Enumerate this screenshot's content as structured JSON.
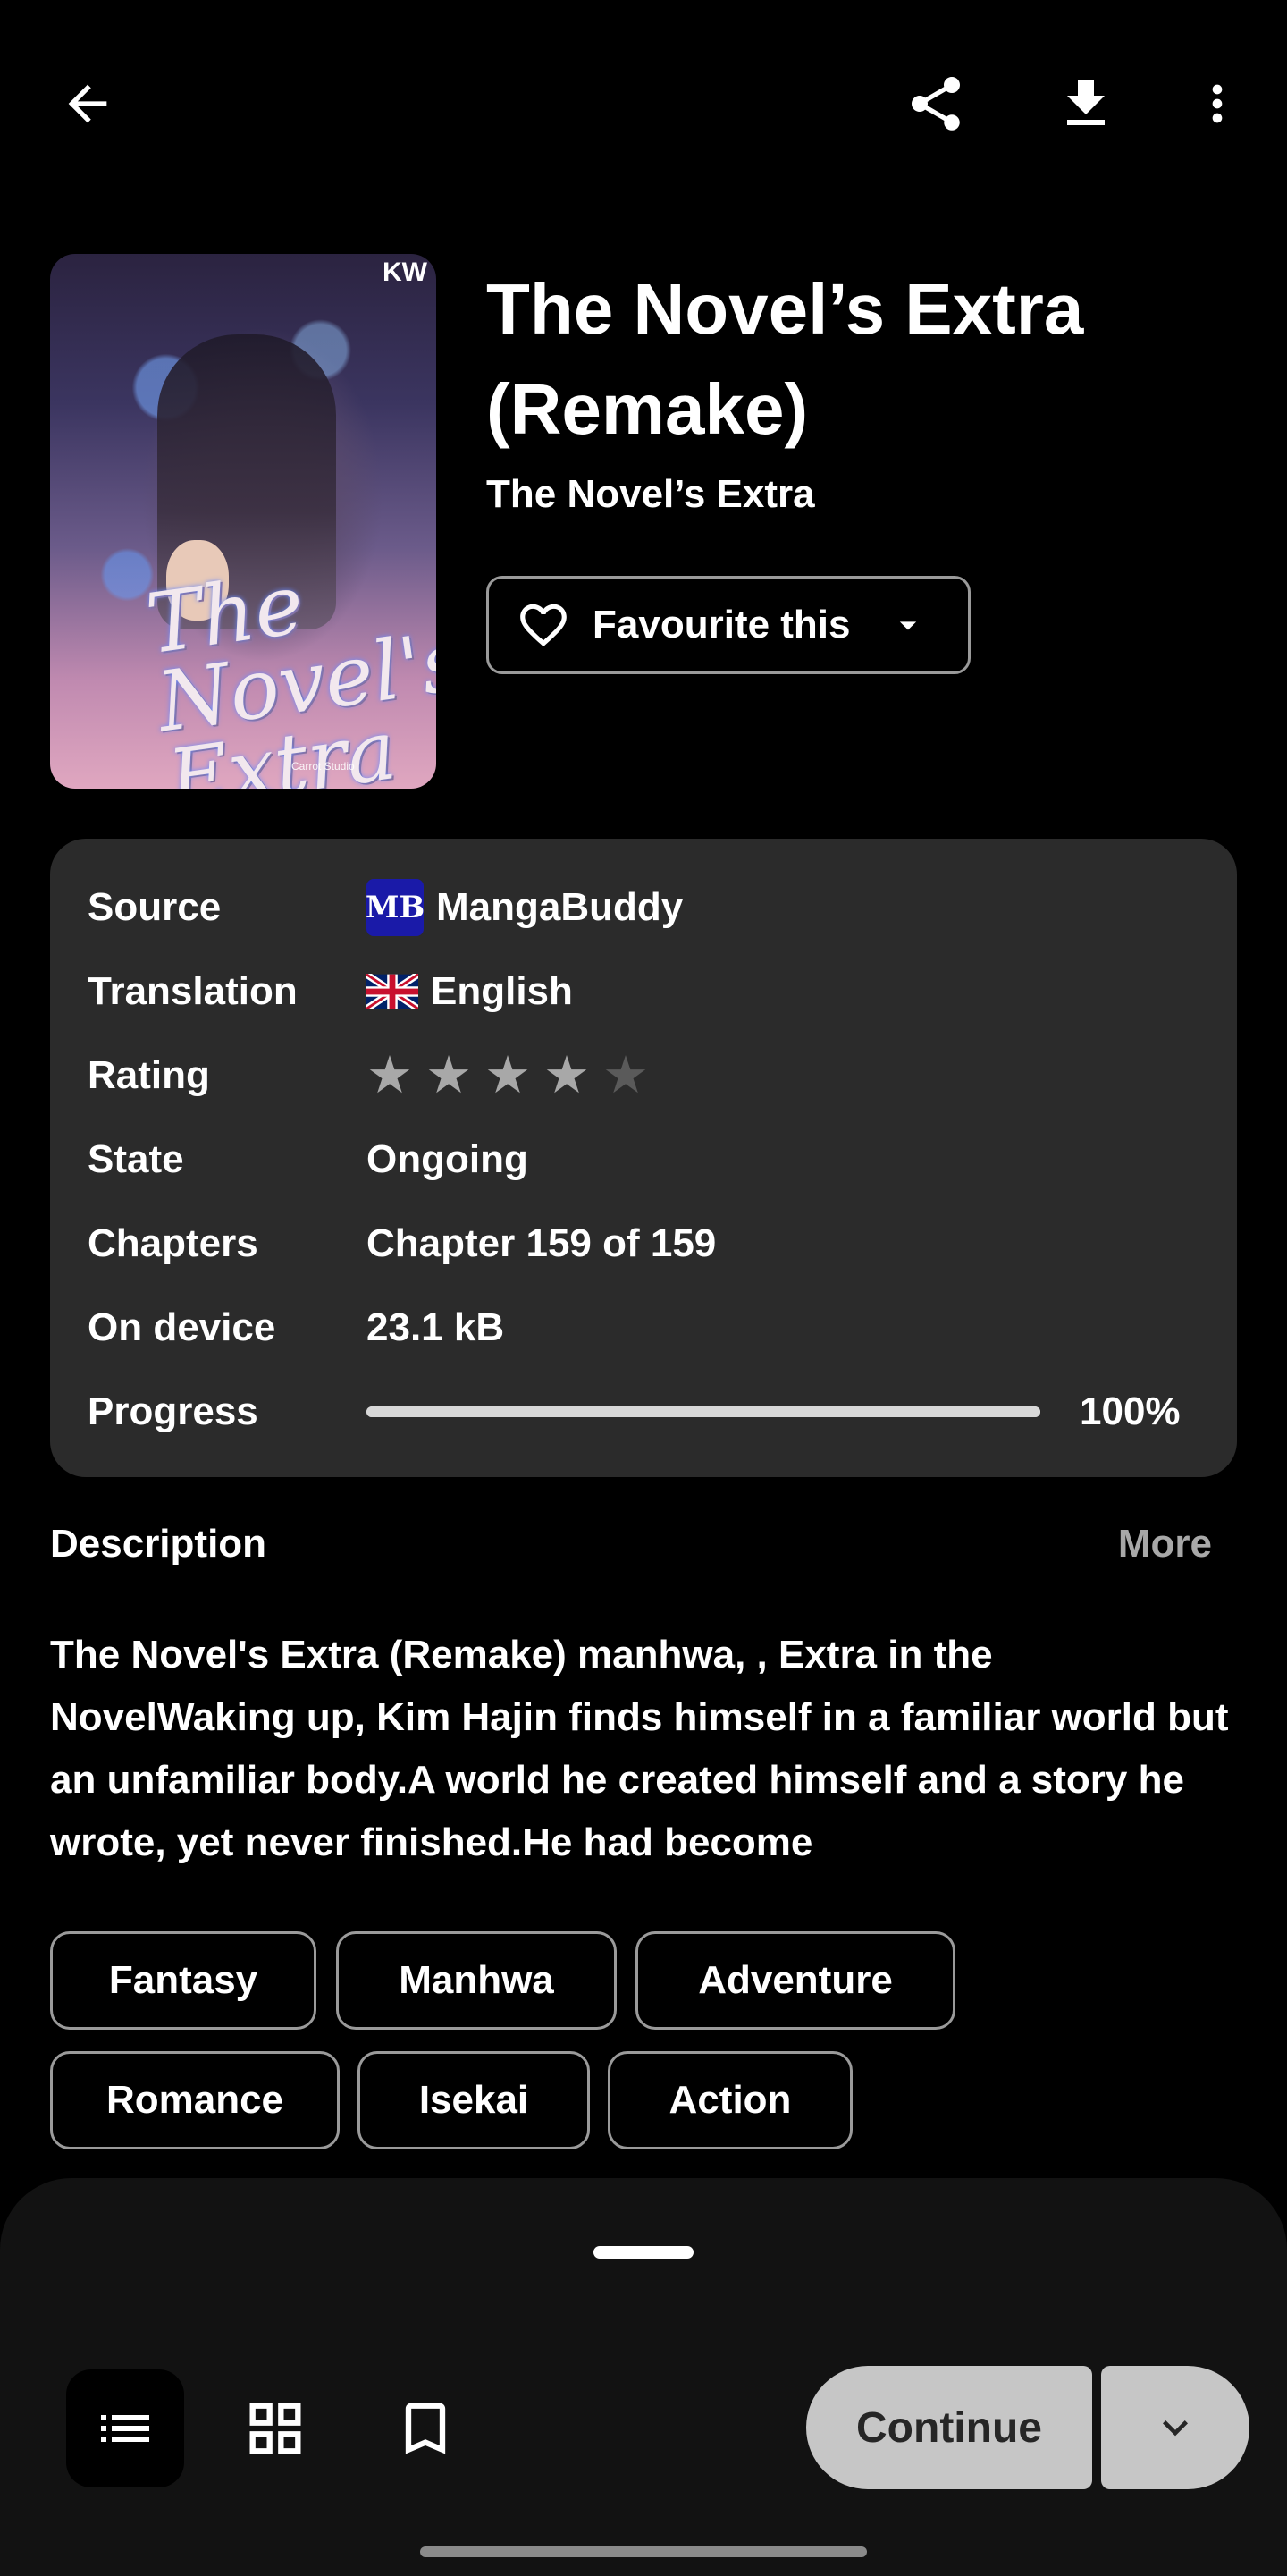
{
  "topbar": {
    "back_icon": "arrow-left-icon",
    "share_icon": "share-icon",
    "download_icon": "download-icon",
    "menu_icon": "more-vertical-icon"
  },
  "cover": {
    "brand": "KW",
    "logo_text": "The Novel's Extra",
    "credit": "Carrot Studio"
  },
  "title": "The Novel’s Extra (Remake)",
  "subtitle": "The Novel’s Extra",
  "favourite": {
    "label": "Favourite this",
    "icon": "heart-outline-icon",
    "caret_icon": "caret-down-icon"
  },
  "info": {
    "source": {
      "key": "Source",
      "value": "MangaBuddy",
      "badge": "MB"
    },
    "translation": {
      "key": "Translation",
      "value": "English",
      "flag": "uk-flag-icon"
    },
    "rating": {
      "key": "Rating",
      "stars_filled": 4,
      "stars_total": 5
    },
    "state": {
      "key": "State",
      "value": "Ongoing"
    },
    "chapters": {
      "key": "Chapters",
      "value": "Chapter 159 of 159"
    },
    "on_device": {
      "key": "On device",
      "value": "23.1 kB"
    },
    "progress": {
      "key": "Progress",
      "value": "100%",
      "fraction": 1.0
    }
  },
  "description": {
    "header": "Description",
    "more": "More",
    "text": "The Novel's Extra (Remake) manhwa, , Extra in the NovelWaking up, Kim Hajin finds himself in a familiar world but an unfamiliar body.A world he created himself and a story he wrote, yet never finished.He had become"
  },
  "tags": [
    "Fantasy",
    "Manhwa",
    "Adventure",
    "Romance",
    "Isekai",
    "Action"
  ],
  "bottom": {
    "view_list_icon": "list-view-icon",
    "view_grid_icon": "grid-view-icon",
    "bookmark_icon": "bookmark-icon",
    "continue_label": "Continue",
    "expand_icon": "chevron-down-icon"
  },
  "colors": {
    "background": "#000000",
    "card": "#2b2b2b",
    "button_fill": "#c6c6c6",
    "muted_text": "#a8a8a8"
  }
}
